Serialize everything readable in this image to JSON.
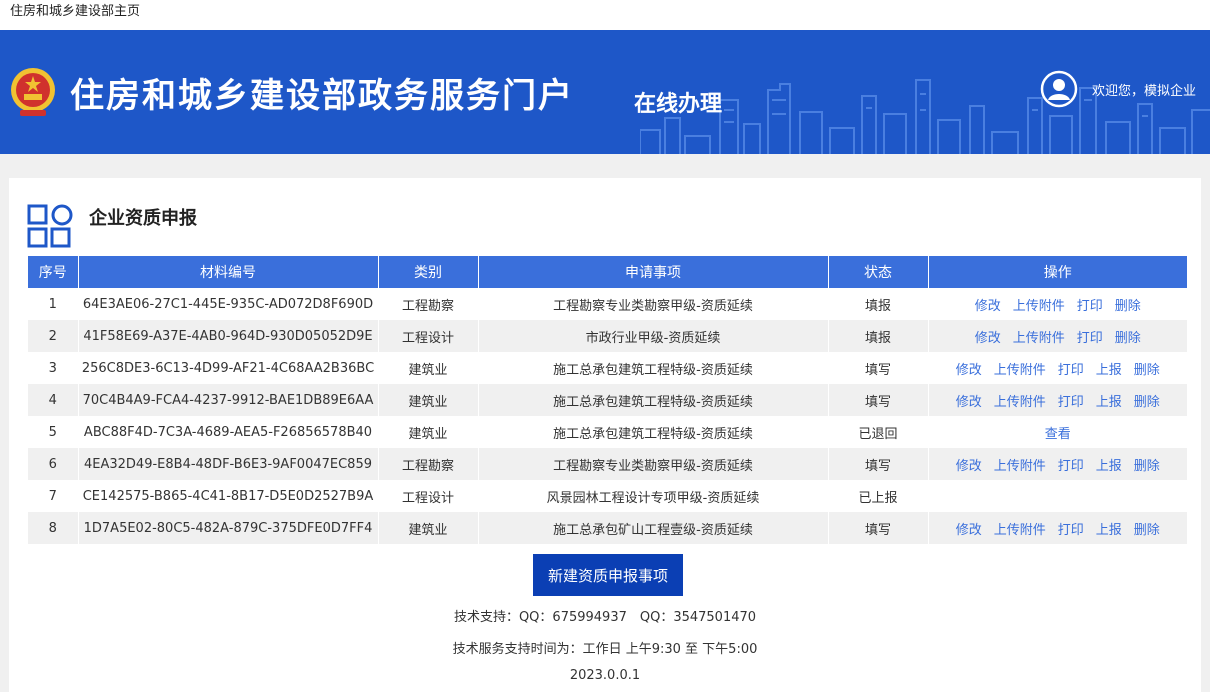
{
  "page": {
    "tab_title": "住房和城乡建设部主页"
  },
  "header": {
    "portal_title": "住房和城乡建设部政务服务门户",
    "section": "在线办理",
    "welcome": "欢迎您，模拟企业"
  },
  "main": {
    "section_title": "企业资质申报",
    "columns": [
      "序号",
      "材料编号",
      "类别",
      "申请事项",
      "状态",
      "操作"
    ],
    "rows": [
      {
        "no": "1",
        "code": "64E3AE06-27C1-445E-935C-AD072D8F690D",
        "category": "工程勘察",
        "item": "工程勘察专业类勘察甲级-资质延续",
        "status": "填报",
        "actions": [
          "修改",
          "上传附件",
          "打印",
          "删除"
        ]
      },
      {
        "no": "2",
        "code": "41F58E69-A37E-4AB0-964D-930D05052D9E",
        "category": "工程设计",
        "item": "市政行业甲级-资质延续",
        "status": "填报",
        "actions": [
          "修改",
          "上传附件",
          "打印",
          "删除"
        ]
      },
      {
        "no": "3",
        "code": "256C8DE3-6C13-4D99-AF21-4C68AA2B36BC",
        "category": "建筑业",
        "item": "施工总承包建筑工程特级-资质延续",
        "status": "填写",
        "actions": [
          "修改",
          "上传附件",
          "打印",
          "上报",
          "删除"
        ]
      },
      {
        "no": "4",
        "code": "70C4B4A9-FCA4-4237-9912-BAE1DB89E6AA",
        "category": "建筑业",
        "item": "施工总承包建筑工程特级-资质延续",
        "status": "填写",
        "actions": [
          "修改",
          "上传附件",
          "打印",
          "上报",
          "删除"
        ]
      },
      {
        "no": "5",
        "code": "ABC88F4D-7C3A-4689-AEA5-F26856578B40",
        "category": "建筑业",
        "item": "施工总承包建筑工程特级-资质延续",
        "status": "已退回",
        "actions": [
          "查看"
        ]
      },
      {
        "no": "6",
        "code": "4EA32D49-E8B4-48DF-B6E3-9AF0047EC859",
        "category": "工程勘察",
        "item": "工程勘察专业类勘察甲级-资质延续",
        "status": "填写",
        "actions": [
          "修改",
          "上传附件",
          "打印",
          "上报",
          "删除"
        ]
      },
      {
        "no": "7",
        "code": "CE142575-B865-4C41-8B17-D5E0D2527B9A",
        "category": "工程设计",
        "item": "风景园林工程设计专项甲级-资质延续",
        "status": "已上报",
        "actions": []
      },
      {
        "no": "8",
        "code": "1D7A5E02-80C5-482A-879C-375DFE0D7FF4",
        "category": "建筑业",
        "item": "施工总承包矿山工程壹级-资质延续",
        "status": "填写",
        "actions": [
          "修改",
          "上传附件",
          "打印",
          "上报",
          "删除"
        ]
      }
    ],
    "new_button": "新建资质申报事项"
  },
  "footer": {
    "support": "技术支持：QQ：675994937　QQ：3547501470",
    "hours": "技术服务支持时间为：工作日 上午9:30 至 下午5:00",
    "version": "2023.0.0.1"
  },
  "colors": {
    "banner": "#1e57c8",
    "table_header": "#3a6fdb",
    "button": "#0b3fb4",
    "link": "#3a6fdb"
  }
}
